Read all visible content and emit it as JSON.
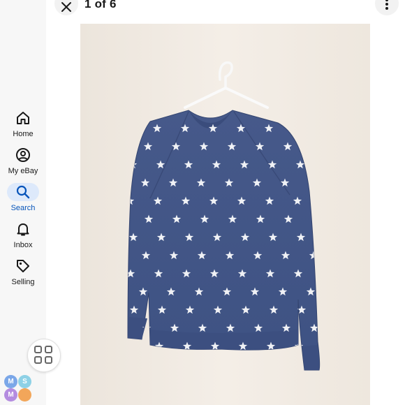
{
  "nav": {
    "items": [
      {
        "label": "Home",
        "icon": "home-icon"
      },
      {
        "label": "My eBay",
        "icon": "account-icon"
      },
      {
        "label": "Search",
        "icon": "search-icon",
        "active": true
      },
      {
        "label": "Inbox",
        "icon": "bell-icon"
      },
      {
        "label": "Selling",
        "icon": "tag-icon"
      }
    ],
    "apps_icon": "apps-grid-icon",
    "avatar_letters": [
      "M",
      "S",
      "M"
    ]
  },
  "viewer": {
    "counter": "1 of 6",
    "close_icon": "close-icon",
    "more_icon": "more-vertical-icon"
  },
  "photo": {
    "subject": "blue crewneck sweatshirt with white star print on hanger",
    "colors": {
      "background": "#f1ebe3",
      "garment": "#4a5d8e",
      "stars": "#ffffff"
    }
  },
  "colors": {
    "accent": "#0654ba",
    "active_pill": "#dde9fb",
    "rail": "#f7f7f7"
  }
}
